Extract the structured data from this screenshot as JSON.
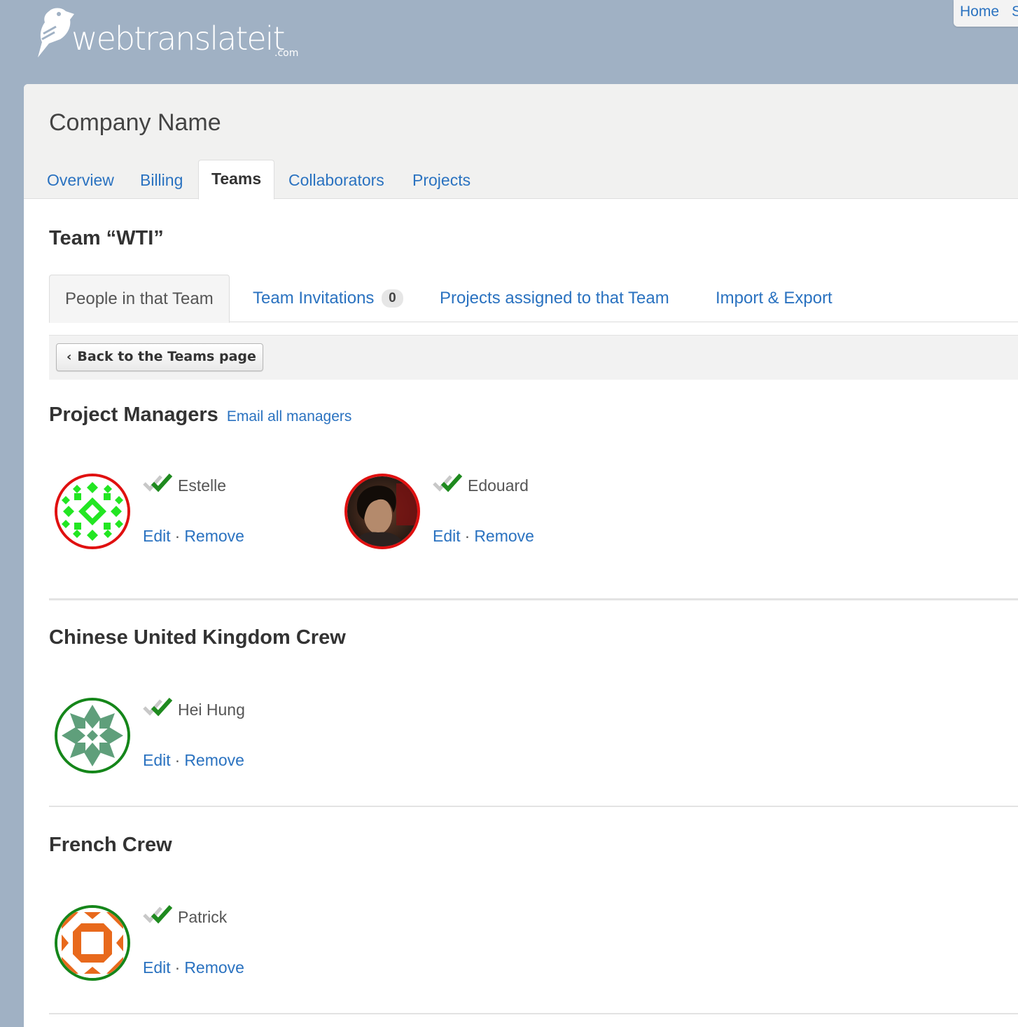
{
  "header": {
    "logo_text": "webtranslateit",
    "logo_suffix": ".com",
    "nav": [
      "Home",
      "S"
    ]
  },
  "company": {
    "name": "Company Name"
  },
  "main_tabs": [
    "Overview",
    "Billing",
    "Teams",
    "Collaborators",
    "Projects"
  ],
  "active_main_tab": "Teams",
  "team": {
    "title": "Team “WTI”"
  },
  "sub_tabs": [
    {
      "label": "People in that Team"
    },
    {
      "label": "Team Invitations",
      "badge": "0"
    },
    {
      "label": "Projects assigned to that Team"
    },
    {
      "label": "Import & Export"
    }
  ],
  "back_button": "Back to the Teams page",
  "sections": [
    {
      "title": "Project Managers",
      "link": "Email all managers",
      "members": [
        {
          "name": "Estelle",
          "edit": "Edit",
          "sep": "·",
          "remove": "Remove",
          "avatar": "green-quilt-identicon",
          "ring_color": "#e01010"
        },
        {
          "name": "Edouard",
          "edit": "Edit",
          "sep": "·",
          "remove": "Remove",
          "avatar": "photo",
          "ring_color": "#e01010"
        }
      ]
    },
    {
      "title": "Chinese United Kingdom Crew",
      "members": [
        {
          "name": "Hei Hung",
          "edit": "Edit",
          "sep": "·",
          "remove": "Remove",
          "avatar": "teal-star-identicon",
          "ring_color": "#15861a"
        }
      ]
    },
    {
      "title": "French Crew",
      "members": [
        {
          "name": "Patrick",
          "edit": "Edit",
          "sep": "·",
          "remove": "Remove",
          "avatar": "orange-quilt-identicon",
          "ring_color": "#15861a"
        }
      ]
    }
  ],
  "colors": {
    "link": "#2a72c0",
    "background": "#a0b1c4",
    "manager_ring": "#e01010",
    "member_ring": "#15861a",
    "check": "#1f8a1f"
  }
}
